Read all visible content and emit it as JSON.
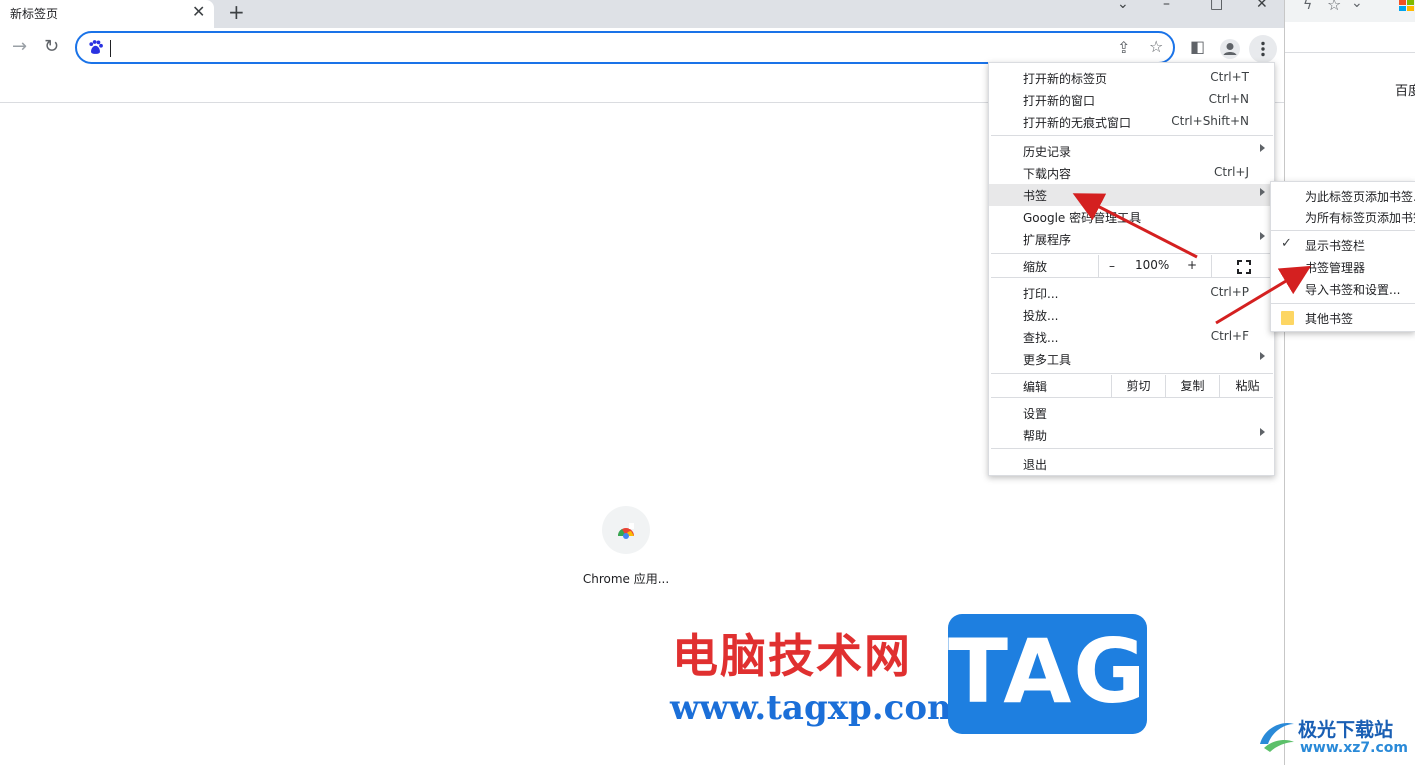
{
  "tab": {
    "title": "新标签页"
  },
  "menu": {
    "items": [
      {
        "label": "打开新的标签页",
        "shortcut": "Ctrl+T"
      },
      {
        "label": "打开新的窗口",
        "shortcut": "Ctrl+N"
      },
      {
        "label": "打开新的无痕式窗口",
        "shortcut": "Ctrl+Shift+N"
      },
      {
        "label": "历史记录",
        "shortcut": ""
      },
      {
        "label": "下载内容",
        "shortcut": "Ctrl+J"
      },
      {
        "label": "书签",
        "shortcut": ""
      },
      {
        "label": "Google 密码管理工具",
        "shortcut": ""
      },
      {
        "label": "扩展程序",
        "shortcut": ""
      },
      {
        "label": "打印...",
        "shortcut": "Ctrl+P"
      },
      {
        "label": "投放...",
        "shortcut": ""
      },
      {
        "label": "查找...",
        "shortcut": "Ctrl+F"
      },
      {
        "label": "更多工具",
        "shortcut": ""
      },
      {
        "label": "设置",
        "shortcut": ""
      },
      {
        "label": "帮助",
        "shortcut": ""
      },
      {
        "label": "退出",
        "shortcut": ""
      }
    ],
    "zoom": {
      "label": "缩放",
      "minus": "–",
      "value": "100%",
      "plus": "+"
    },
    "edit": {
      "label": "编辑",
      "cut": "剪切",
      "copy": "复制",
      "paste": "粘贴"
    }
  },
  "submenu": {
    "items": [
      {
        "label": "为此标签页添加书签..."
      },
      {
        "label": "为所有标签页添加书签..."
      },
      {
        "label": "显示书签栏"
      },
      {
        "label": "书签管理器"
      },
      {
        "label": "导入书签和设置..."
      },
      {
        "label": "其他书签"
      }
    ]
  },
  "shortcut_tile": {
    "label": "Chrome 应用..."
  },
  "right_window": {
    "text": "百度"
  },
  "watermark": {
    "site_name": "电脑技术网",
    "site_url": "www.tagxp.com",
    "tag": "TAG",
    "site2_name": "极光下载站",
    "site2_url": "www.xz7.com"
  },
  "colors": {
    "accent": "#1a73e8",
    "arrow": "#d42020",
    "watermark_red": "#e03030",
    "watermark_blue": "#1e7fe0"
  }
}
